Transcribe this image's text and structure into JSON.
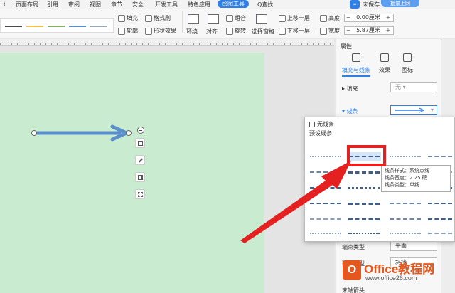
{
  "menu": {
    "tabs": [
      "页面布局",
      "引用",
      "审阅",
      "视图",
      "章节",
      "安全",
      "开发工具",
      "特色应用",
      "绘图工具"
    ],
    "search": "Q查找",
    "unsaved": "未保存",
    "cloud": "批量上网"
  },
  "toolbar": {
    "fill": "填充",
    "format_painter": "格式刷",
    "outline": "轮廓",
    "shape_effect": "形状效果",
    "wrap": "环绕",
    "align": "对齐",
    "group": "组合",
    "rotate": "旋转",
    "selection_pane": "选择窗格",
    "bring_forward": "上移一层",
    "send_backward": "下移一层",
    "height_label": "高度:",
    "height_value": "0.00厘米",
    "width_label": "宽度:",
    "width_value": "5.87厘米"
  },
  "panel": {
    "title": "属性",
    "tabs": [
      "填充与线条",
      "效果",
      "图标"
    ],
    "fill_label": "填充",
    "fill_value": "无",
    "line_label": "线条",
    "end_type_label": "端点类型",
    "end_type_value": "平面",
    "join_type_label": "联接类型",
    "join_type_value": "斜接",
    "arrow_label": "末端箭头"
  },
  "dropdown": {
    "no_line": "无线条",
    "preset": "预设线条",
    "tooltip_lines": [
      "线条样式：系统点线",
      "线条宽度：2.25 磅",
      "线条类型：单线"
    ]
  },
  "watermark": {
    "logo": "O",
    "title": "Office教程网",
    "url": "www.office26.com"
  },
  "colors": {
    "accent": "#2e7fe6",
    "page": "#c9ebd0",
    "arrow": "#5b8fc9",
    "highlight": "#e52020",
    "watermark": "#e5581d"
  }
}
